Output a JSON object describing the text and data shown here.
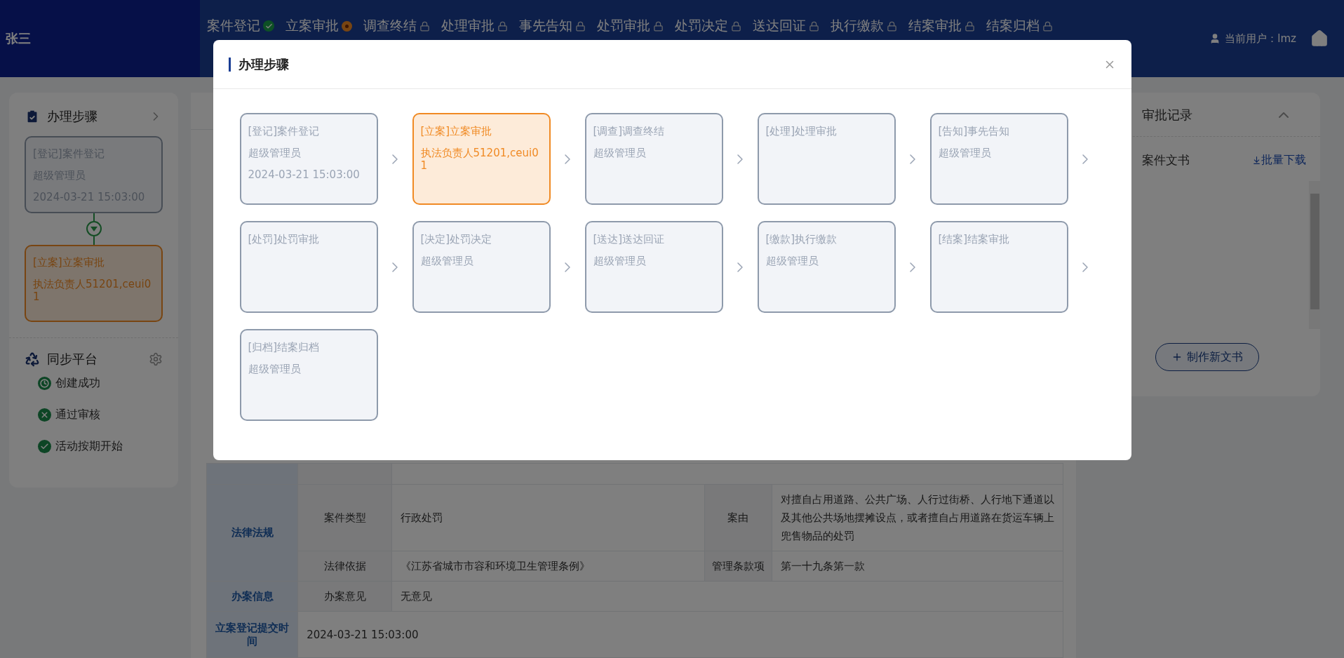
{
  "header": {
    "user_name": "张三",
    "nav": [
      {
        "label": "案件登记",
        "kind": "done"
      },
      {
        "label": "立案审批",
        "kind": "current"
      },
      {
        "label": "调查终结",
        "kind": "locked"
      },
      {
        "label": "处理审批",
        "kind": "locked"
      },
      {
        "label": "事先告知",
        "kind": "locked"
      },
      {
        "label": "处罚审批",
        "kind": "locked"
      },
      {
        "label": "处罚决定",
        "kind": "locked"
      },
      {
        "label": "送达回证",
        "kind": "locked"
      },
      {
        "label": "执行缴款",
        "kind": "locked"
      },
      {
        "label": "结案审批",
        "kind": "locked"
      },
      {
        "label": "结案归档",
        "kind": "locked"
      }
    ],
    "current_user": "当前用户：lmz"
  },
  "side": {
    "steps_title": "办理步骤",
    "steps": [
      {
        "label": "[登记]案件登记",
        "lines": [
          "超级管理员",
          "2024-03-21 15:03:00"
        ],
        "selected": false
      },
      {
        "label": "[立案]立案审批",
        "lines": [
          "执法负责人51201,ceui01"
        ],
        "selected": true
      }
    ],
    "sync_title": "同步平台",
    "events": [
      {
        "label": "创建成功",
        "kind": "clock"
      },
      {
        "label": "通过审核",
        "kind": "cross"
      },
      {
        "label": "活动按期开始",
        "kind": "check"
      }
    ]
  },
  "table": {
    "sections": [
      {
        "heading": "法律法规",
        "rows": [
          {
            "cells": [
              "案件类型",
              "行政处罚",
              "案由",
              "对擅自占用道路、公共广场、人行过街桥、人行地下通道以及其他公共场地摆摊设点，或者擅自占用道路在货运车辆上兜售物品的处罚"
            ]
          },
          {
            "cells": [
              "法律依据",
              "《江苏省城市市容和环境卫生管理条例》",
              "管理条款项",
              "第一十九条第一款"
            ]
          }
        ]
      },
      {
        "heading": "办案信息",
        "rows": [
          {
            "cells": [
              "办案意见",
              "无意见"
            ]
          }
        ]
      },
      {
        "heading": "立案登记提交时间",
        "rows": [
          {
            "cells": [
              "2024-03-21 15:03:00"
            ]
          }
        ]
      }
    ]
  },
  "right": {
    "title": "审批记录",
    "docs_title": "案件文书",
    "download": "批量下载",
    "new_doc": "制作新文书"
  },
  "modal": {
    "title": "办理步骤",
    "steps": [
      {
        "label": "[登记]案件登记",
        "lines": [
          "超级管理员",
          "2024-03-21 15:03:00"
        ],
        "selected": false
      },
      {
        "label": "[立案]立案审批",
        "lines": [
          "执法负责人51201,ceui01"
        ],
        "selected": true
      },
      {
        "label": "[调查]调查终结",
        "lines": [
          "超级管理员"
        ],
        "selected": false
      },
      {
        "label": "[处理]处理审批",
        "selected": false
      },
      {
        "label": "[告知]事先告知",
        "lines": [
          "超级管理员"
        ],
        "selected": false
      },
      {
        "label": "[处罚]处罚审批",
        "selected": false
      },
      {
        "label": "[决定]处罚决定",
        "lines": [
          "超级管理员"
        ],
        "selected": false
      },
      {
        "label": "[送达]送达回证",
        "lines": [
          "超级管理员"
        ],
        "selected": false
      },
      {
        "label": "[缴款]执行缴款",
        "lines": [
          "超级管理员"
        ],
        "selected": false
      },
      {
        "label": "[结案]结案审批",
        "selected": false
      },
      {
        "label": "[归档]结案归档",
        "lines": [
          "超级管理员"
        ],
        "selected": false
      }
    ]
  }
}
